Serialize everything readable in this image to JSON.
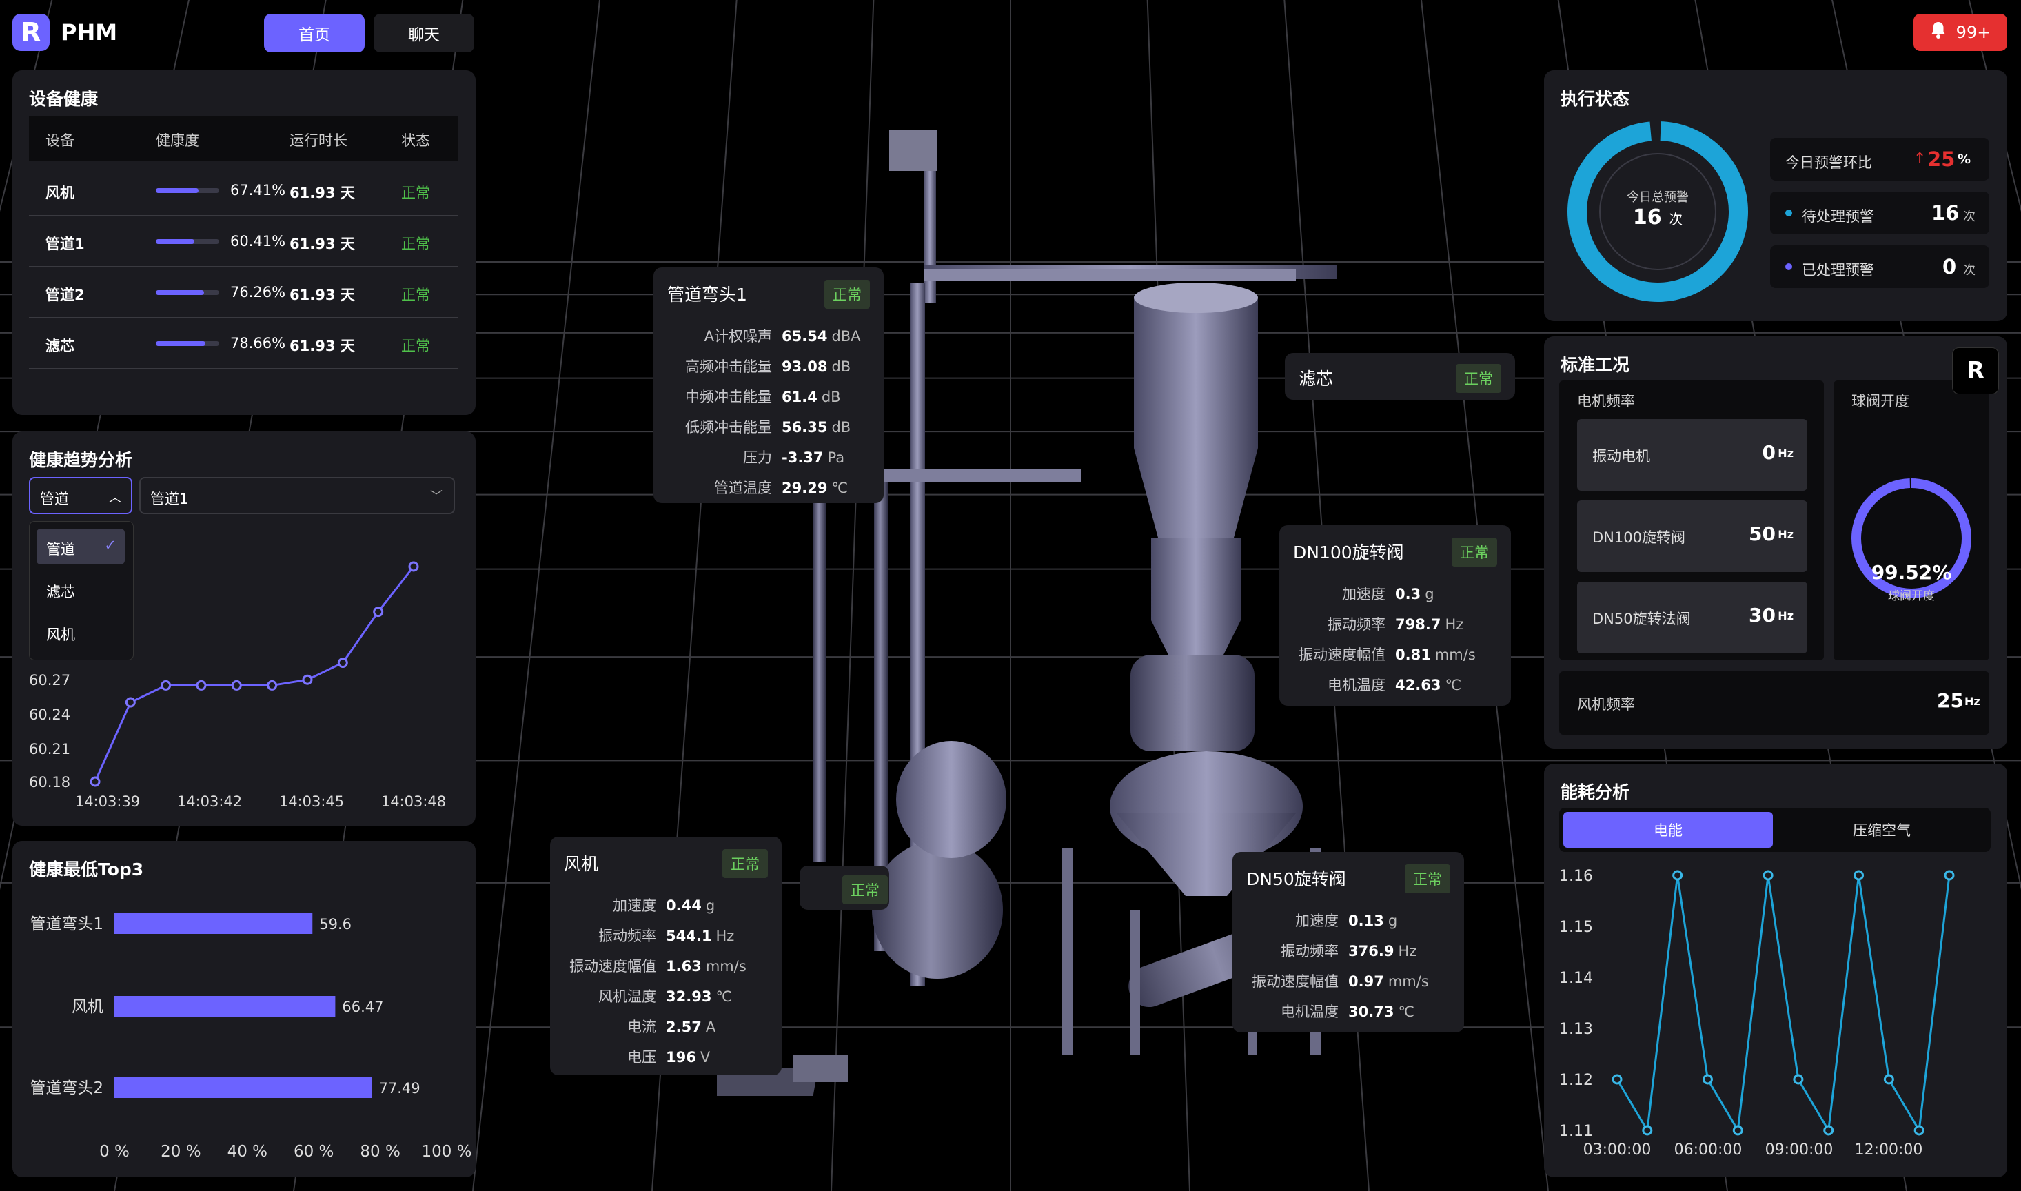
{
  "app": {
    "logo": "R",
    "name": "PHM",
    "tabs": [
      "首页",
      "聊天"
    ],
    "alerts": "99+"
  },
  "health": {
    "title": "设备健康",
    "headers": [
      "设备",
      "健康度",
      "运行时长",
      "状态"
    ],
    "rows": [
      {
        "name": "风机",
        "pct": "67.41%",
        "fill": 0.6741,
        "dur": "61.93 天",
        "status": "正常"
      },
      {
        "name": "管道1",
        "pct": "60.41%",
        "fill": 0.6041,
        "dur": "61.93 天",
        "status": "正常"
      },
      {
        "name": "管道2",
        "pct": "76.26%",
        "fill": 0.7626,
        "dur": "61.93 天",
        "status": "正常"
      },
      {
        "name": "滤芯",
        "pct": "78.66%",
        "fill": 0.7866,
        "dur": "61.93 天",
        "status": "正常"
      }
    ]
  },
  "trend": {
    "title": "健康趋势分析",
    "sel1": "管道",
    "sel2": "管道1",
    "options": [
      "管道",
      "滤芯",
      "风机"
    ],
    "yticks": [
      "60.27",
      "60.24",
      "60.21",
      "60.18"
    ],
    "xticks": [
      "14:03:39",
      "14:03:42",
      "14:03:45",
      "14:03:48"
    ]
  },
  "top3": {
    "title": "健康最低Top3",
    "xticks": [
      "0 %",
      "20 %",
      "40 %",
      "60 %",
      "80 %",
      "100 %"
    ]
  },
  "status": {
    "title": "执行状态",
    "ring_label": "今日总预警",
    "ring_value": "16",
    "ring_unit": "次",
    "ratio_label": "今日预警环比",
    "ratio_value": "25",
    "ratio_unit": "%",
    "pending_label": "待处理预警",
    "pending_value": "16",
    "pending_unit": "次",
    "done_label": "已处理预警",
    "done_value": "0",
    "done_unit": "次",
    "ring_fill": 0.98
  },
  "standard": {
    "title": "标准工况",
    "motor_title": "电机频率",
    "valve_title": "球阀开度",
    "items": [
      {
        "label": "振动电机",
        "value": "0",
        "unit": "Hz"
      },
      {
        "label": "DN100旋转阀",
        "value": "50",
        "unit": "Hz"
      },
      {
        "label": "DN50旋转法阀",
        "value": "30",
        "unit": "Hz"
      }
    ],
    "valve_value": "99.52%",
    "valve_label": "球阀开度",
    "valve_fill": 0.9952,
    "fan_label": "风机频率",
    "fan_value": "25",
    "fan_unit": "Hz"
  },
  "energy": {
    "title": "能耗分析",
    "tabs": [
      "电能",
      "压缩空气"
    ],
    "yticks": [
      "1.16",
      "1.15",
      "1.14",
      "1.13",
      "1.12",
      "1.11"
    ],
    "xticks": [
      "03:00:00",
      "06:00:00",
      "09:00:00",
      "12:00:00"
    ]
  },
  "cards": {
    "elbow": {
      "title": "管道弯头1",
      "status": "正常",
      "rows": [
        {
          "k": "A计权噪声",
          "v": "65.54",
          "u": "dBA"
        },
        {
          "k": "高频冲击能量",
          "v": "93.08",
          "u": "dB"
        },
        {
          "k": "中频冲击能量",
          "v": "61.4",
          "u": "dB"
        },
        {
          "k": "低频冲击能量",
          "v": "56.35",
          "u": "dB"
        },
        {
          "k": "压力",
          "v": "-3.37",
          "u": "Pa"
        },
        {
          "k": "管道温度",
          "v": "29.29",
          "u": "℃"
        }
      ]
    },
    "filter": {
      "title": "滤芯",
      "status": "正常"
    },
    "dn100": {
      "title": "DN100旋转阀",
      "status": "正常",
      "rows": [
        {
          "k": "加速度",
          "v": "0.3",
          "u": "g"
        },
        {
          "k": "振动频率",
          "v": "798.7",
          "u": "Hz"
        },
        {
          "k": "振动速度幅值",
          "v": "0.81",
          "u": "mm/s"
        },
        {
          "k": "电机温度",
          "v": "42.63",
          "u": "℃"
        }
      ]
    },
    "fan": {
      "title": "风机",
      "status": "正常",
      "rows": [
        {
          "k": "加速度",
          "v": "0.44",
          "u": "g"
        },
        {
          "k": "振动频率",
          "v": "544.1",
          "u": "Hz"
        },
        {
          "k": "振动速度幅值",
          "v": "1.63",
          "u": "mm/s"
        },
        {
          "k": "风机温度",
          "v": "32.93",
          "u": "℃"
        },
        {
          "k": "电流",
          "v": "2.57",
          "u": "A"
        },
        {
          "k": "电压",
          "v": "196",
          "u": "V"
        }
      ]
    },
    "extra_status": "正常",
    "dn50": {
      "title": "DN50旋转阀",
      "status": "正常",
      "rows": [
        {
          "k": "加速度",
          "v": "0.13",
          "u": "g"
        },
        {
          "k": "振动频率",
          "v": "376.9",
          "u": "Hz"
        },
        {
          "k": "振动速度幅值",
          "v": "0.97",
          "u": "mm/s"
        },
        {
          "k": "电机温度",
          "v": "30.73",
          "u": "℃"
        }
      ]
    }
  },
  "chart_data": [
    {
      "type": "line",
      "title": "健康趋势分析",
      "x": [
        "14:03:39",
        "14:03:40",
        "14:03:41",
        "14:03:42",
        "14:03:43",
        "14:03:44",
        "14:03:45",
        "14:03:46",
        "14:03:47",
        "14:03:48"
      ],
      "values": [
        60.18,
        60.25,
        60.265,
        60.265,
        60.265,
        60.265,
        60.27,
        60.285,
        60.33,
        60.37
      ],
      "ylim": [
        60.18,
        60.37
      ]
    },
    {
      "type": "bar",
      "title": "健康最低Top3",
      "categories": [
        "管道弯头1",
        "风机",
        "管道弯头2"
      ],
      "values": [
        59.6,
        66.47,
        77.49
      ],
      "xlim": [
        0,
        100
      ]
    },
    {
      "type": "line",
      "title": "能耗分析",
      "x": [
        "02:00",
        "03:00",
        "04:00",
        "05:00",
        "06:00",
        "07:00",
        "08:00",
        "09:00",
        "10:00",
        "11:00",
        "12:00",
        "13:00",
        "14:00"
      ],
      "values": [
        1.12,
        1.11,
        1.16,
        1.12,
        1.11,
        1.16,
        1.12,
        1.11,
        1.16,
        1.12,
        1.11,
        1.16,
        null
      ],
      "ylim": [
        1.11,
        1.16
      ]
    }
  ]
}
